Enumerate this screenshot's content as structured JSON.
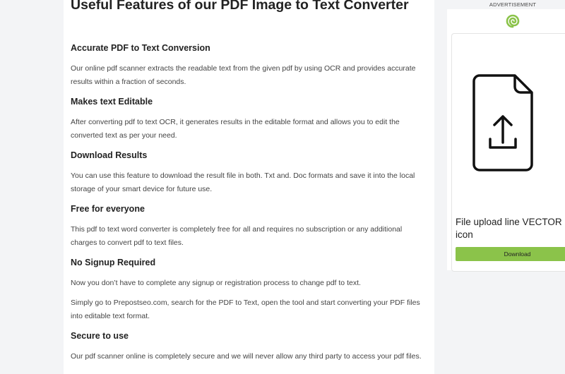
{
  "article": {
    "title": "Useful Features of our PDF Image to Text Converter",
    "sections": [
      {
        "heading": "Accurate PDF to Text Conversion",
        "paragraphs": [
          "Our online pdf scanner extracts the readable text from the given pdf by using OCR and provides accurate results within a fraction of seconds."
        ]
      },
      {
        "heading": "Makes text Editable",
        "paragraphs": [
          "After converting pdf to text OCR, it generates results in the editable format and allows you to edit the converted text as per your need."
        ]
      },
      {
        "heading": "Download Results",
        "paragraphs": [
          "You can use this feature to download the result file in both. Txt and. Doc formats and save it into the local storage of your smart device for future use."
        ]
      },
      {
        "heading": "Free for everyone",
        "paragraphs": [
          "This pdf to text word converter is completely free for all and requires no subscription or any additional charges to convert pdf to text files."
        ]
      },
      {
        "heading": "No Signup Required",
        "paragraphs": [
          "Now you don’t have to complete any signup or registration process to change pdf to text.",
          "Simply go to Prepostseo.com, search for the PDF to Text, open the tool and start converting your PDF files into editable text format."
        ]
      },
      {
        "heading": "Secure to use",
        "paragraphs": [
          "Our pdf scanner online is completely secure and we will never allow any third party to access your pdf files."
        ]
      }
    ]
  },
  "ad": {
    "label": "ADVERTISEMENT",
    "logo_icon": "spiral-logo-icon",
    "image_icon": "file-upload-icon",
    "caption": "File upload line VECTOR icon",
    "button_label": "Download",
    "button_color": "#8bc34a",
    "logo_color": "#8bc34a"
  }
}
